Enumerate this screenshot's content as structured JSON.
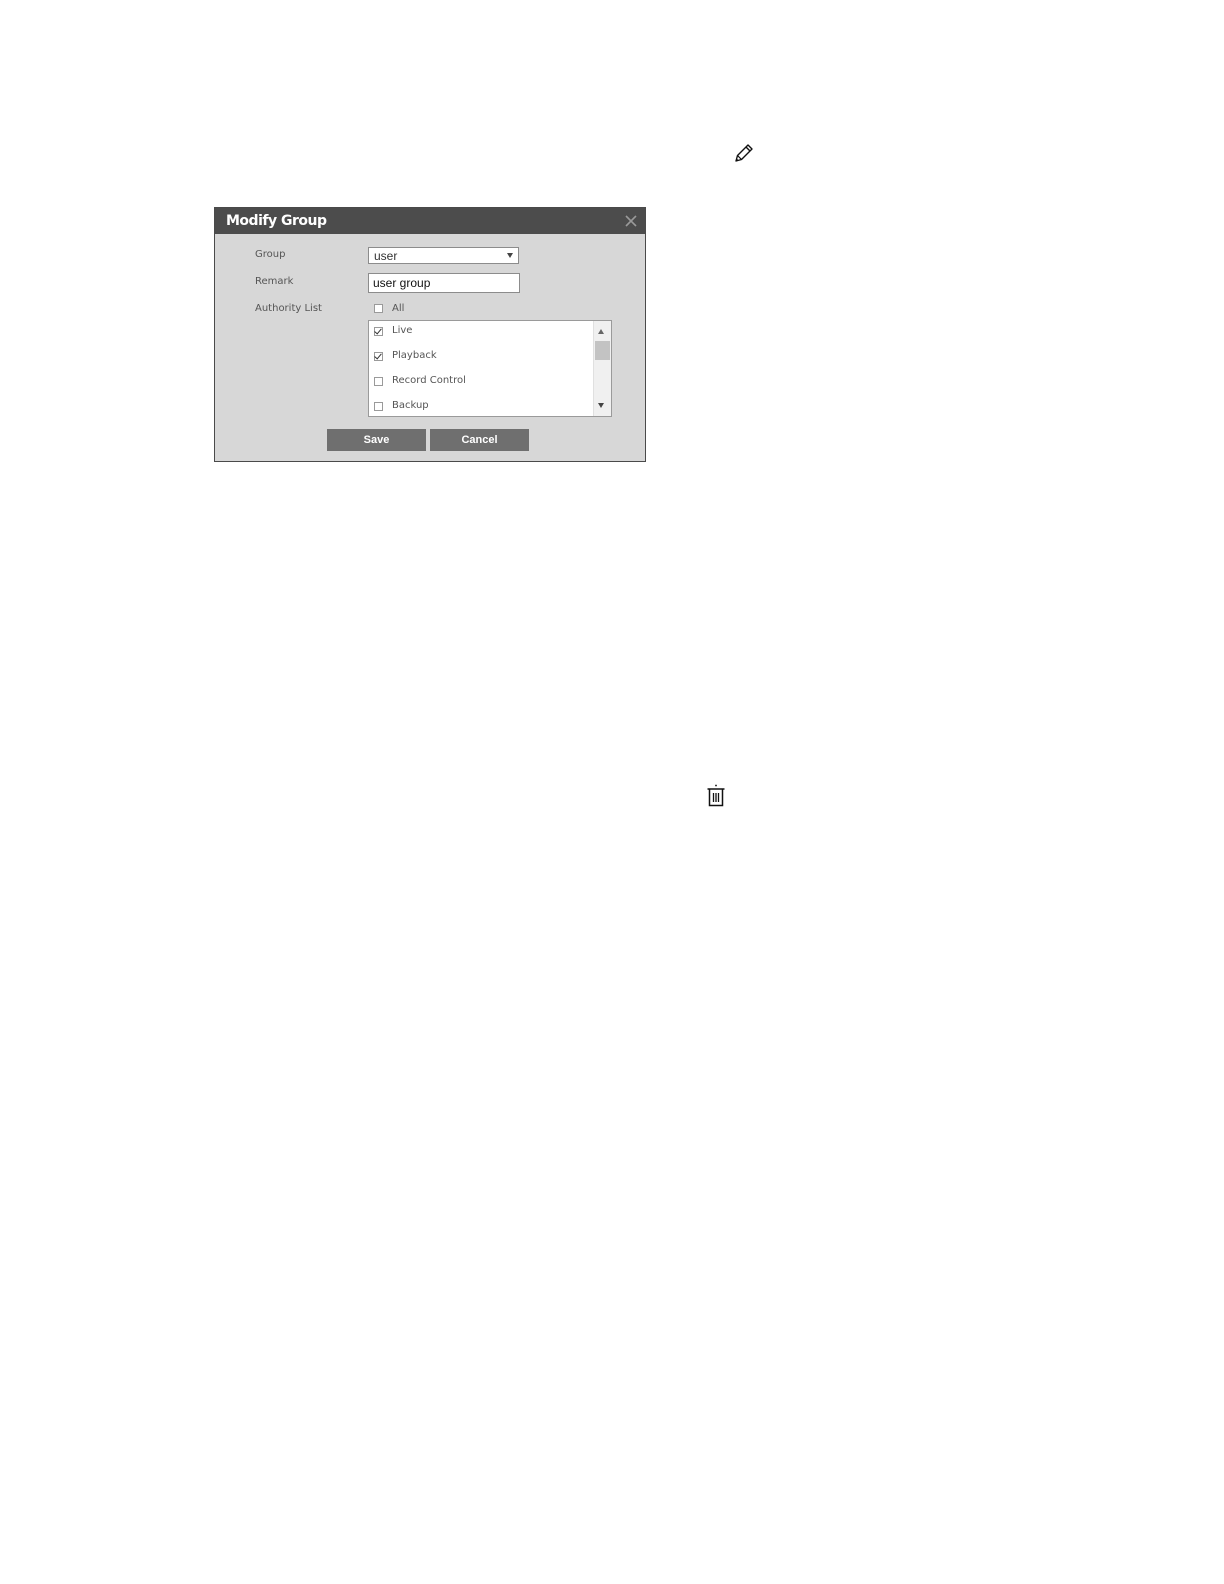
{
  "icons": {
    "edit": "pencil-icon",
    "delete": "trash-icon",
    "close": "close-icon"
  },
  "dialog": {
    "title": "Modify Group",
    "group_label": "Group",
    "group_value": "user",
    "remark_label": "Remark",
    "remark_value": "user group",
    "authority_label": "Authority List",
    "all_label": "All",
    "all_checked": false,
    "authority_items": [
      {
        "label": "Live",
        "checked": true
      },
      {
        "label": "Playback",
        "checked": true
      },
      {
        "label": "Record Control",
        "checked": false
      },
      {
        "label": "Backup",
        "checked": false
      }
    ],
    "save_label": "Save",
    "cancel_label": "Cancel"
  },
  "colors": {
    "header_bg": "#4c4c4c",
    "dialog_bg": "#d7d7d7",
    "button_bg": "#6f6f6f"
  }
}
